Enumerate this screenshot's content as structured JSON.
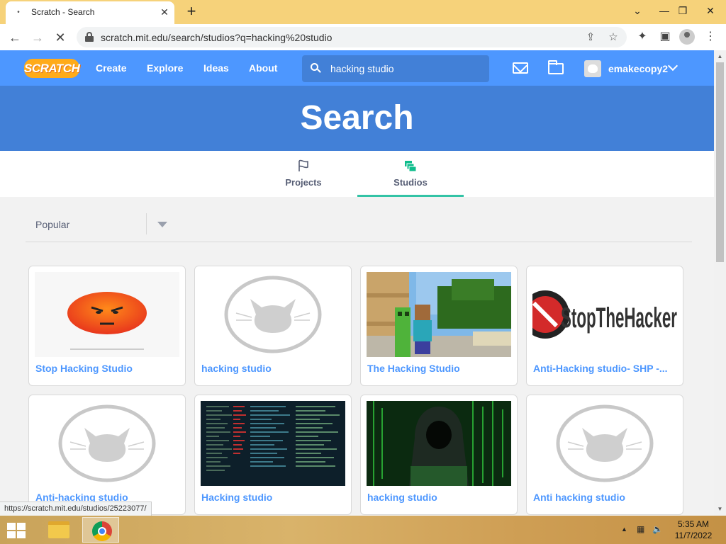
{
  "browser": {
    "tab_title": "Scratch - Search",
    "tab_close": "✕",
    "new_tab": "+",
    "url": "scratch.mit.edu/search/studios?q=hacking%20studio",
    "status_url": "https://scratch.mit.edu/studios/25223077/",
    "window_controls": {
      "minimize": "⌄",
      "restore": "—",
      "maximize": "❐",
      "close": "✕"
    }
  },
  "nav": {
    "logo": "SCRATCH",
    "links": {
      "create": "Create",
      "explore": "Explore",
      "ideas": "Ideas",
      "about": "About"
    },
    "search_value": "hacking studio",
    "username": "emakecopy2"
  },
  "banner": {
    "title": "Search"
  },
  "tabs": [
    {
      "label": "Projects",
      "icon": "flag-icon",
      "active": false
    },
    {
      "label": "Studios",
      "icon": "studio-icon",
      "active": true
    }
  ],
  "filter": {
    "selected": "Popular"
  },
  "results": [
    {
      "title": "Stop Hacking Studio",
      "thumb": "angry-face"
    },
    {
      "title": "hacking studio",
      "thumb": "default-cat"
    },
    {
      "title": "The Hacking Studio",
      "thumb": "minecraft"
    },
    {
      "title": "Anti-Hacking studio- SHP -...",
      "thumb": "stopthehacker"
    },
    {
      "title": "Anti-hacking studio",
      "thumb": "default-cat"
    },
    {
      "title": "Hacking studio",
      "thumb": "code-screen"
    },
    {
      "title": "hacking studio",
      "thumb": "hooded-hacker"
    },
    {
      "title": "Anti hacking studio",
      "thumb": "default-cat"
    }
  ],
  "thumb_text": {
    "stopthehacker": "StopTheHacker"
  },
  "taskbar": {
    "time": "5:35 AM",
    "date": "11/7/2022"
  },
  "colors": {
    "scratch_blue": "#4d97ff",
    "banner_blue": "#4280d7",
    "tab_active": "#33c3a6",
    "title_bar": "#f6d27a"
  }
}
